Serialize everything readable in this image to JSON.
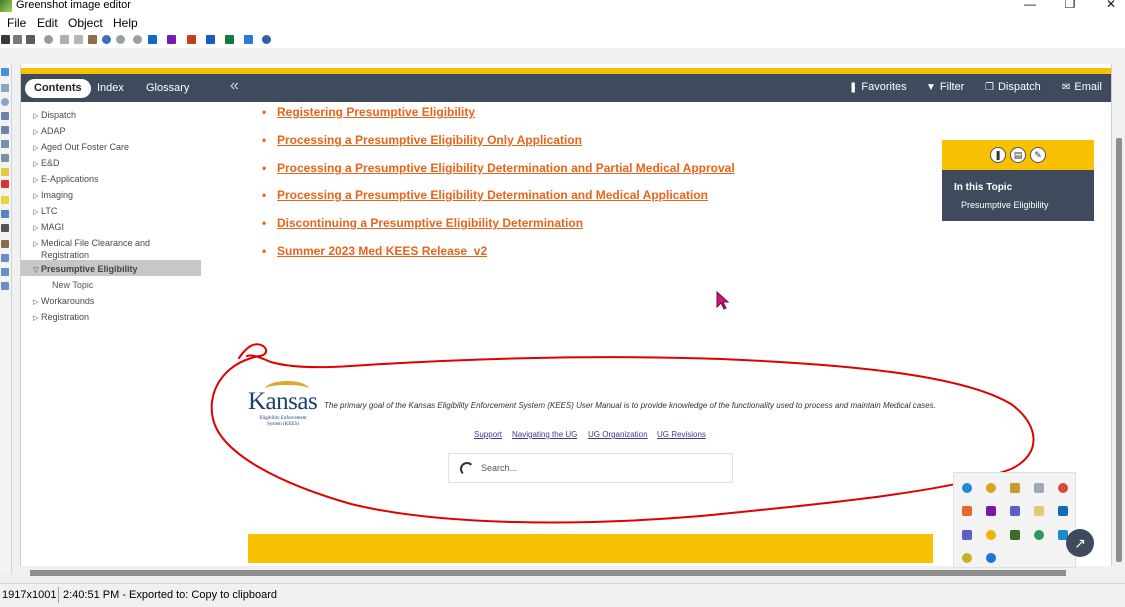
{
  "window": {
    "title": "Greenshot image editor",
    "controls": {
      "minimize": "—",
      "maximize": "❐",
      "close": "✕"
    }
  },
  "menu": [
    "File",
    "Edit",
    "Object",
    "Help"
  ],
  "toolbar_icons": [
    "save-icon",
    "new-icon",
    "print-icon",
    "undo-icon",
    "cut-icon",
    "copy-icon",
    "paste-icon",
    "redo-icon",
    "rotate-icon",
    "outlook-icon",
    "onenote-icon",
    "powerpoint-icon",
    "word-icon",
    "excel-icon",
    "image-icon",
    "help-icon"
  ],
  "nav": {
    "tabs": [
      "Contents",
      "Index",
      "Glossary"
    ],
    "collapse_glyph": "«",
    "actions": [
      {
        "label": "Favorites",
        "icon": "bookmark-icon",
        "glyph": "❚"
      },
      {
        "label": "Filter",
        "icon": "filter-icon",
        "glyph": "▼"
      },
      {
        "label": "Dispatch",
        "icon": "document-icon",
        "glyph": "❐"
      },
      {
        "label": "Email",
        "icon": "email-icon",
        "glyph": "✉"
      }
    ]
  },
  "tree": {
    "items": [
      "Dispatch",
      "ADAP",
      "Aged Out Foster Care",
      "E&D",
      "E-Applications",
      "Imaging",
      "LTC",
      "MAGI"
    ],
    "multiline_item": [
      "Medical File Clearance and",
      "Registration"
    ],
    "selected": "Presumptive Eligibility",
    "selected_child": "New Topic",
    "after_items": [
      "Workarounds",
      "Registration"
    ]
  },
  "links": [
    "Registering Presumptive Eligibility",
    "Processing a Presumptive Eligibility Only Application",
    "Processing a Presumptive Eligibility Determination and Partial Medical Approval",
    "Processing a Presumptive Eligibility Determination and Medical Application",
    "Discontinuing a Presumptive Eligibility Determination",
    "Summer 2023 Med KEES Release_v2"
  ],
  "topic_panel": {
    "title": "In this Topic",
    "link": "Presumptive Eligibility",
    "buttons": [
      "bookmark-icon",
      "print-icon",
      "highlight-icon"
    ]
  },
  "footer": {
    "logo_word": "Kansas",
    "logo_sub": "Eligibility Enforcement System (KEES)",
    "text": "The primary goal of the Kansas Eligibility Enforcement System (KEES) User Manual is to provide knowledge of the functionality used to process and maintain Medical cases.",
    "links": [
      "Support",
      "Navigating the UG",
      "UG Organization",
      "UG Revisions"
    ],
    "search_placeholder": "Search..."
  },
  "status": {
    "dimensions": "1917x1001",
    "message": "2:40:51 PM - Exported to: Copy to clipboard"
  },
  "colors": {
    "nav_bg": "#3d4b5c",
    "gold": "#f7c000",
    "link": "#e8641a",
    "annotation": "#e00000"
  }
}
